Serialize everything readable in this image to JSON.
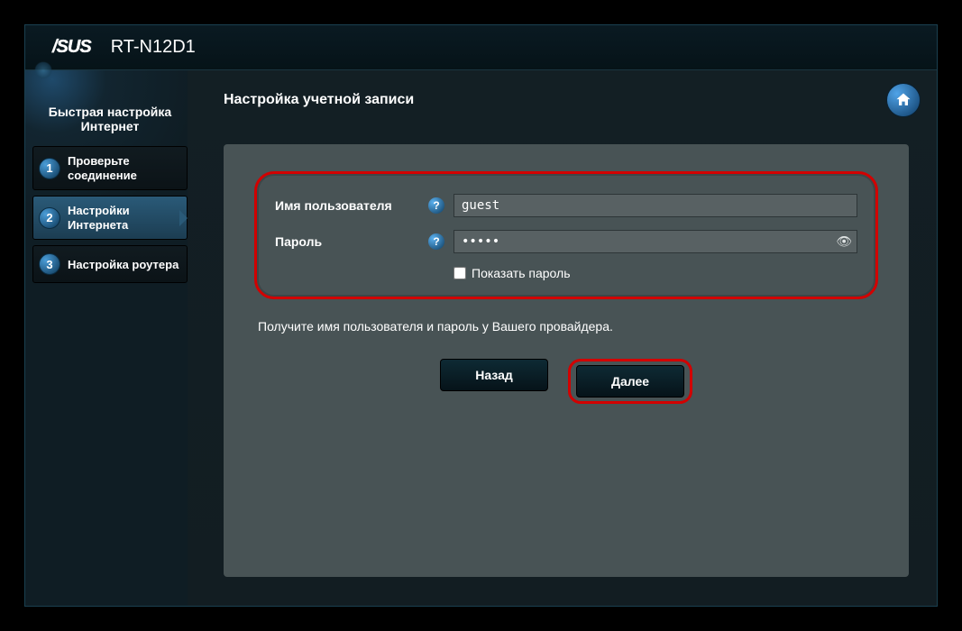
{
  "header": {
    "brand": "/SUS",
    "model": "RT-N12D1"
  },
  "sidebar": {
    "title": "Быстрая настройка Интернет",
    "steps": [
      {
        "num": "1",
        "label": "Проверьте соединение"
      },
      {
        "num": "2",
        "label": "Настройки Интернета"
      },
      {
        "num": "3",
        "label": "Настройка роутера"
      }
    ]
  },
  "main": {
    "title": "Настройка учетной записи",
    "fields": {
      "username_label": "Имя пользователя",
      "username_value": "guest",
      "password_label": "Пароль",
      "password_value": "•••••",
      "show_password_label": "Показать пароль"
    },
    "hint": "Получите имя пользователя и пароль у Вашего провайдера.",
    "buttons": {
      "back": "Назад",
      "next": "Далее"
    }
  }
}
